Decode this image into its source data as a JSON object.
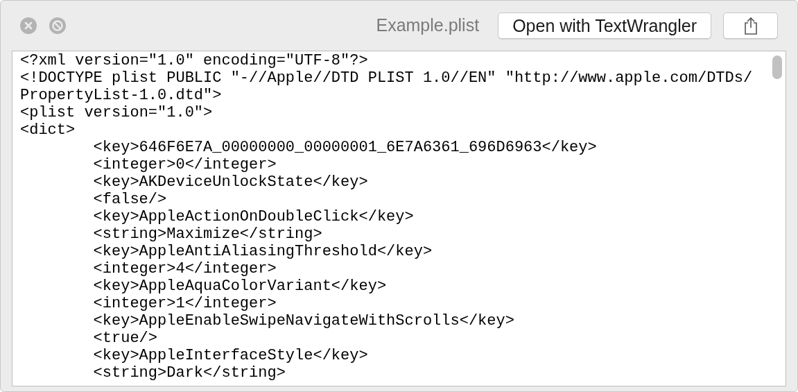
{
  "window": {
    "title": "Example.plist"
  },
  "toolbar": {
    "open_button": "Open with TextWrangler"
  },
  "document": {
    "lines": [
      {
        "text": "<?xml version=\"1.0\" encoding=\"UTF-8\"?>"
      },
      {
        "text": "<!DOCTYPE plist PUBLIC \"-//Apple//DTD PLIST 1.0//EN\" \"http://www.apple.com/DTDs/PropertyList-1.0.dtd\">"
      },
      {
        "text": "<plist version=\"1.0\">"
      },
      {
        "text": "<dict>",
        "children": [
          {
            "text": "<key>646F6E7A_00000000_00000001_6E7A6361_696D6963</key>"
          },
          {
            "text": "<integer>0</integer>"
          },
          {
            "text": "<key>AKDeviceUnlockState</key>"
          },
          {
            "text": "<false/>"
          },
          {
            "text": "<key>AppleActionOnDoubleClick</key>"
          },
          {
            "text": "<string>Maximize</string>"
          },
          {
            "text": "<key>AppleAntiAliasingThreshold</key>"
          },
          {
            "text": "<integer>4</integer>"
          },
          {
            "text": "<key>AppleAquaColorVariant</key>"
          },
          {
            "text": "<integer>1</integer>"
          },
          {
            "text": "<key>AppleEnableSwipeNavigateWithScrolls</key>"
          },
          {
            "text": "<true/>"
          },
          {
            "text": "<key>AppleInterfaceStyle</key>"
          },
          {
            "text": "<string>Dark</string>"
          }
        ]
      }
    ]
  }
}
